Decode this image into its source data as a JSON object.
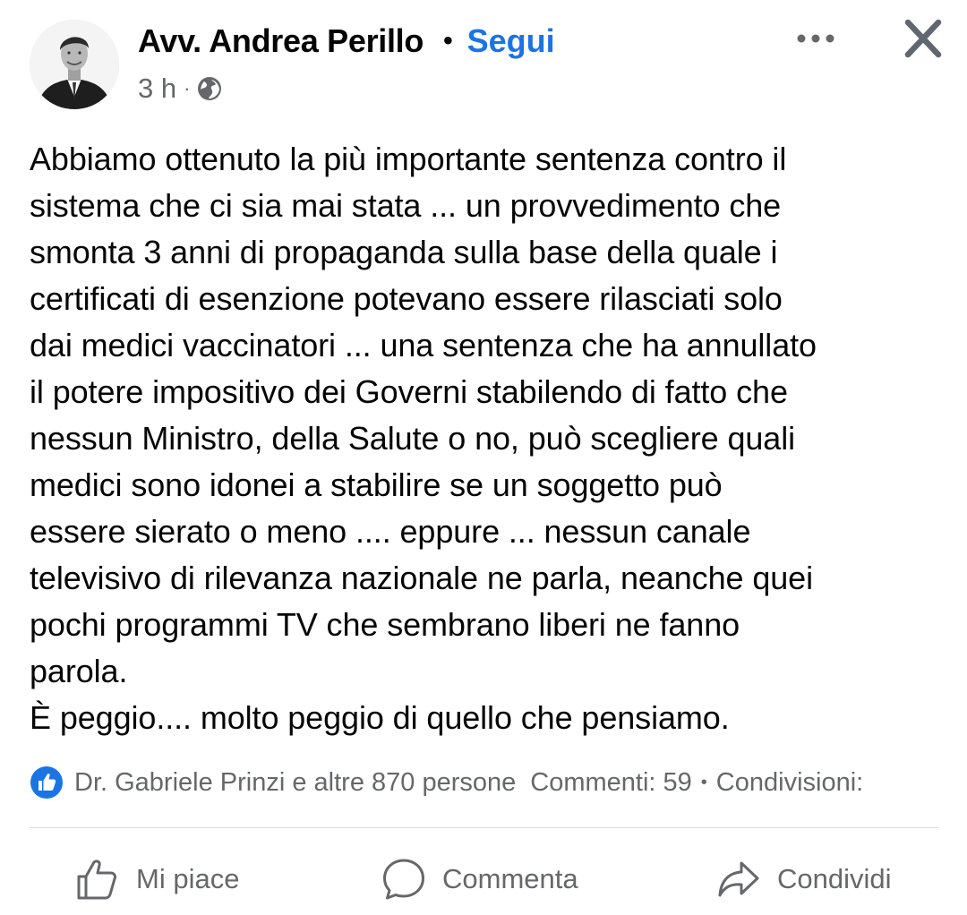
{
  "post": {
    "author": "Avv. Andrea Perillo",
    "separator": "•",
    "follow_label": "Segui",
    "time": "3 h",
    "meta_separator": "·",
    "audience_icon": "globe-icon",
    "text": "Abbiamo ottenuto la più importante sentenza contro il\nsistema che ci sia mai stata ... un provvedimento che\nsmonta 3 anni di propaganda sulla base della quale i\ncertificati di esenzione potevano essere rilasciati solo\ndai medici vaccinatori ... una sentenza che ha annullato\nil potere impositivo dei Governi stabilendo di fatto che\nnessun Ministro, della Salute o no, può scegliere quali\nmedici sono idonei a stabilire se un soggetto può\nessere sierato o meno .... eppure ... nessun canale\ntelevisivo di rilevanza nazionale ne parla, neanche quei\npochi programmi TV che sembrano liberi ne fanno\nparola.\nÈ peggio.... molto peggio di quello che pensiamo."
  },
  "stats": {
    "reactors": "Dr. Gabriele Prinzi e altre 870 persone",
    "comments": "Commenti: 59",
    "separator": "•",
    "shares": "Condivisioni:"
  },
  "actions": {
    "like": "Mi piace",
    "comment": "Commenta",
    "share": "Condividi"
  },
  "colors": {
    "accent": "#1b74e4",
    "secondary_text": "#65676b",
    "primary_text": "#050505",
    "divider": "#dadde1"
  }
}
